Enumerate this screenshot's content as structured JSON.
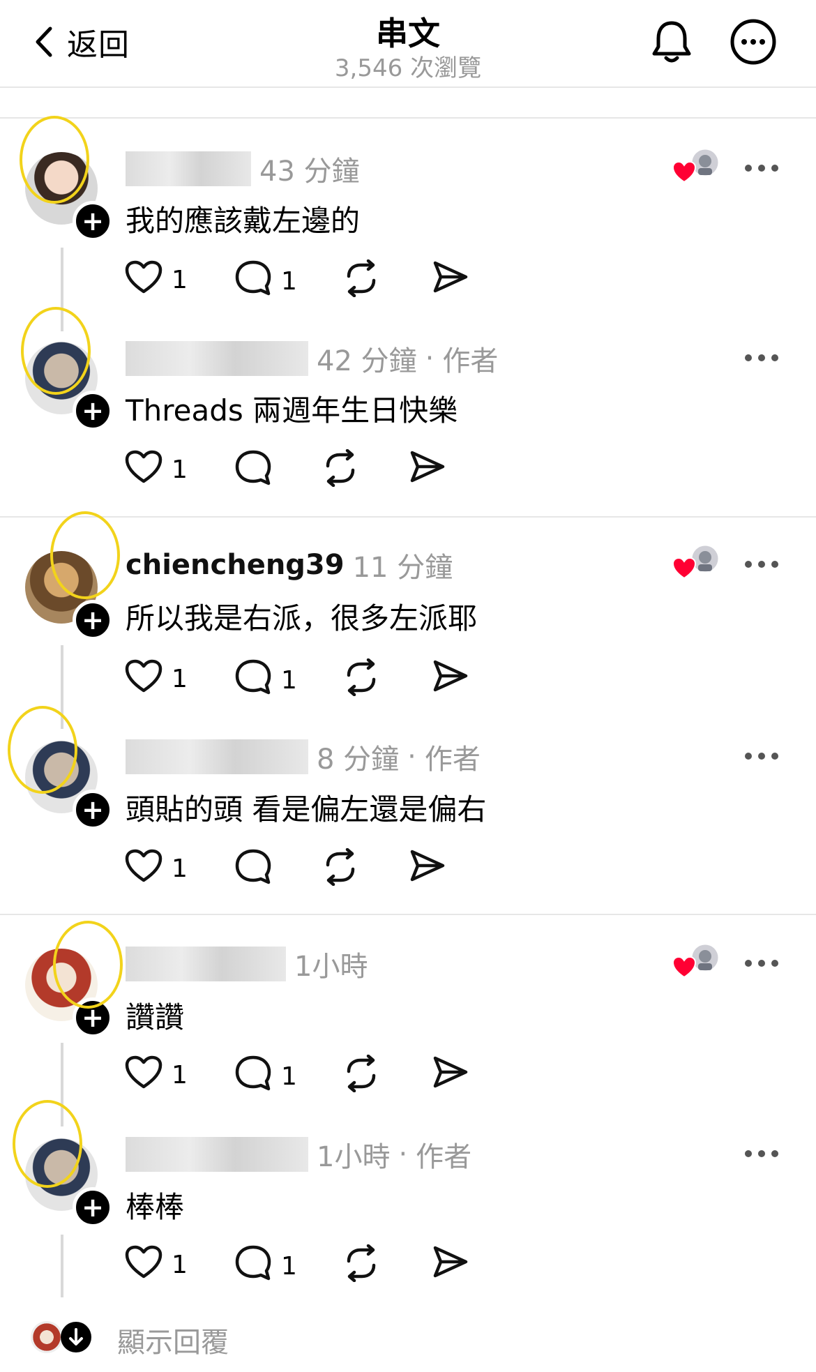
{
  "header": {
    "back_label": "返回",
    "title": "串文",
    "views": "3,546 次瀏覽"
  },
  "comments": [
    {
      "username": "",
      "time": "43 分鐘",
      "author_tag": "",
      "text": "我的應該戴左邊的",
      "likes": "1",
      "replies": "1",
      "liked_by_author": true
    },
    {
      "username": "",
      "time": "42 分鐘",
      "author_tag": "作者",
      "text": "Threads 兩週年生日快樂",
      "likes": "1",
      "replies": "",
      "liked_by_author": false
    },
    {
      "username": "chiencheng39",
      "time": "11 分鐘",
      "author_tag": "",
      "text": "所以我是右派，很多左派耶",
      "likes": "1",
      "replies": "1",
      "liked_by_author": true
    },
    {
      "username": "",
      "time": "8 分鐘",
      "author_tag": "作者",
      "text": "頭貼的頭 看是偏左還是偏右",
      "likes": "1",
      "replies": "",
      "liked_by_author": false
    },
    {
      "username": "",
      "time": "1小時",
      "author_tag": "",
      "text": "讚讚",
      "likes": "1",
      "replies": "1",
      "liked_by_author": true
    },
    {
      "username": "",
      "time": "1小時",
      "author_tag": "作者",
      "text": "棒棒",
      "likes": "1",
      "replies": "1",
      "liked_by_author": false
    }
  ],
  "show_replies_label": "顯示回覆",
  "colors": {
    "accent_heart": "#ff0033",
    "meta_gray": "#999999",
    "hat_ring": "#f2d31b"
  },
  "icons": [
    "chevron-left-icon",
    "bell-icon",
    "more-circle-icon",
    "heart-icon",
    "comment-icon",
    "repost-icon",
    "send-icon",
    "more-dots-icon",
    "plus-icon",
    "arrow-down-icon"
  ]
}
